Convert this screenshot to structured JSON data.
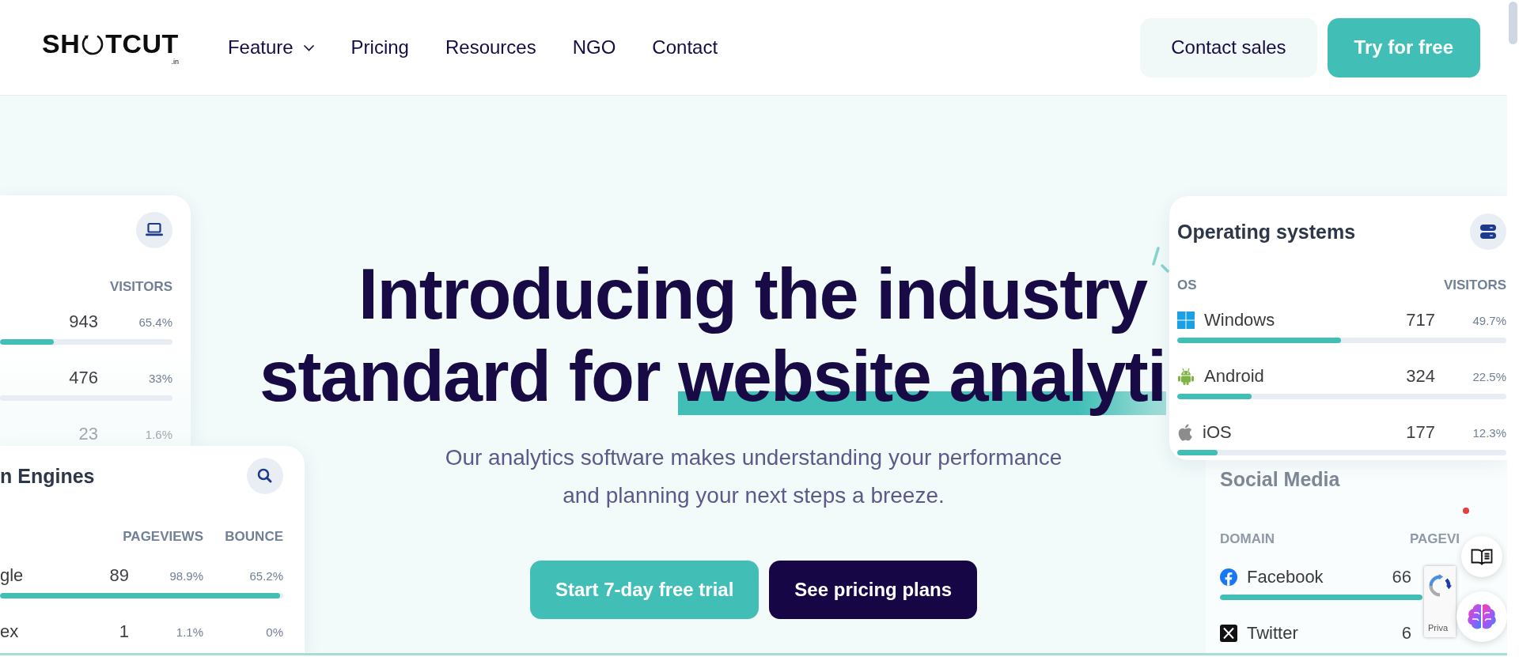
{
  "header": {
    "logo": {
      "text_before_ring": "SH",
      "text_after_ring": "TCUT",
      "suffix": ".in"
    },
    "nav": [
      {
        "label": "Feature",
        "dropdown": true
      },
      {
        "label": "Pricing",
        "dropdown": false
      },
      {
        "label": "Resources",
        "dropdown": false
      },
      {
        "label": "NGO",
        "dropdown": false
      },
      {
        "label": "Contact",
        "dropdown": false
      }
    ],
    "actions": [
      {
        "label": "Contact sales",
        "kind": "secondary"
      },
      {
        "label": "Try for free",
        "kind": "primary"
      }
    ]
  },
  "hero": {
    "heading": {
      "line_1": "Introducing the industry",
      "line_2": [
        {
          "text": "standard for",
          "highlighted": false
        },
        {
          "text": "website analyti",
          "highlighted": true
        }
      ]
    },
    "subtitle": "Our analytics software makes understanding your performance and planning your next steps a breeze.",
    "buttons": [
      {
        "label": "Start 7-day free trial",
        "kind": "primary"
      },
      {
        "label": "See pricing plans",
        "kind": "secondary"
      }
    ]
  },
  "left_cards": [
    {
      "faded": false,
      "headings": [
        "VISITORS"
      ],
      "rows": [
        {
          "value": "943",
          "share": "65.4%",
          "level": 0.31
        },
        {
          "value": "476",
          "share": "33%",
          "level": 0
        },
        {
          "value": "23",
          "share": "1.6%"
        }
      ]
    },
    {
      "title": "n Engines",
      "faded": false,
      "headings": [
        "PAGEVIEWS",
        "BOUNCE"
      ],
      "rows": [
        {
          "name": "gle",
          "value": "89",
          "share": "98.9%",
          "bounce": "65.2%",
          "level": 0.99
        },
        {
          "name": "ex",
          "value": "1",
          "share": "1.1%",
          "bounce": "0%"
        }
      ]
    }
  ],
  "right_cards": [
    {
      "title": "Operating systems",
      "faded": false,
      "name_heading": "OS",
      "headings": [
        "VISITORS"
      ],
      "rows": [
        {
          "name": "Windows",
          "value": "717",
          "share": "49.7%",
          "level": 0.497
        },
        {
          "name": "Android",
          "value": "324",
          "share": "22.5%",
          "level": 0.225
        },
        {
          "name": "iOS",
          "value": "177",
          "share": "12.3%",
          "level": 0.123
        }
      ]
    },
    {
      "title": "Social Media",
      "faded": true,
      "indicator_dot": true,
      "name_heading": "DOMAIN",
      "headings": [
        "PAGEVI"
      ],
      "rows": [
        {
          "name": "Facebook",
          "value": "66",
          "level": 1
        },
        {
          "name": "Twitter",
          "value": "6"
        }
      ]
    }
  ],
  "widgets": {
    "privacy_badge": {
      "label": "Priva"
    }
  }
}
